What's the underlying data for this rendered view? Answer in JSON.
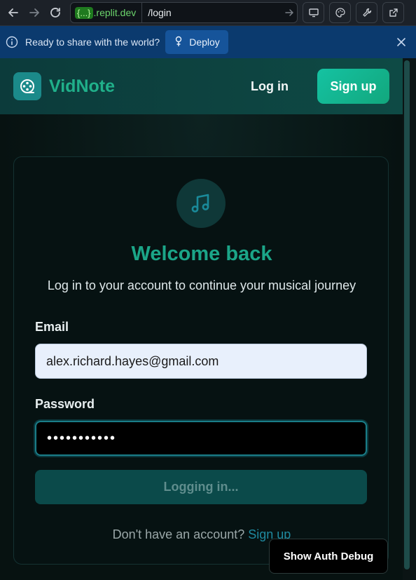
{
  "browser": {
    "url_host_braces": "{...}",
    "url_host_domain": ".replit.dev",
    "url_path": "/login"
  },
  "banner": {
    "text": "Ready to share with the world?",
    "deploy_label": "Deploy"
  },
  "header": {
    "brand": "VidNote",
    "login_label": "Log in",
    "signup_label": "Sign up"
  },
  "card": {
    "title": "Welcome back",
    "subtitle": "Log in to your account to continue your musical journey",
    "email_label": "Email",
    "email_value": "alex.richard.hayes@gmail.com",
    "password_label": "Password",
    "password_value": "•••••••••••",
    "submit_label": "Logging in...",
    "footer_text": "Don't have an account?",
    "footer_link": "Sign up"
  },
  "debug": {
    "label": "Show Auth Debug"
  },
  "colors": {
    "brand": "#20b08a",
    "accent": "#15c2a2",
    "banner_bg": "#0b3a6e"
  }
}
